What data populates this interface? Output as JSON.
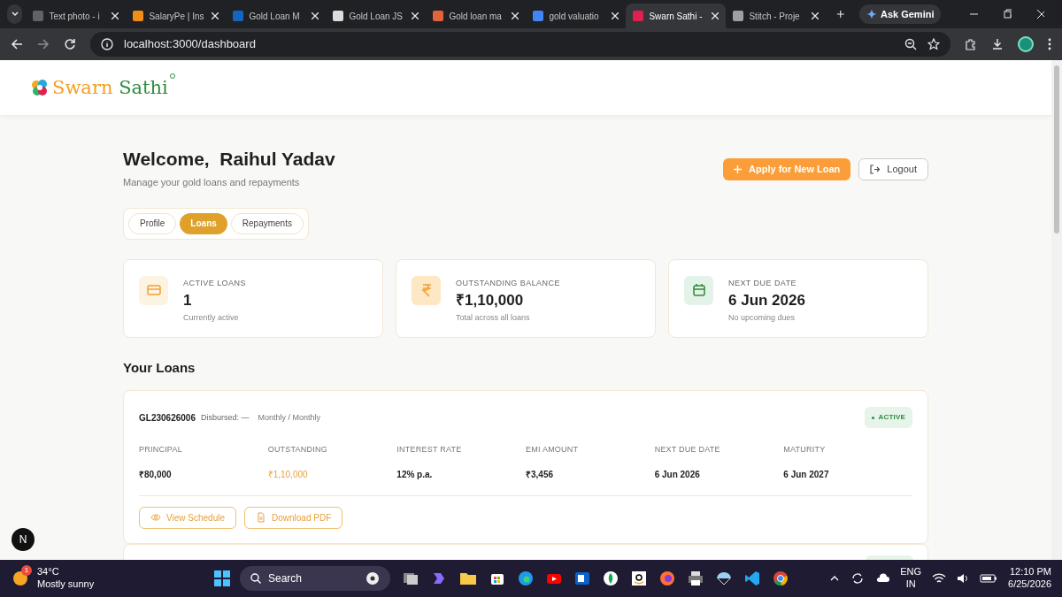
{
  "browser": {
    "tabs": [
      {
        "label": "Text photo - i",
        "selected": false
      },
      {
        "label": "SalaryPe | Ins",
        "selected": false
      },
      {
        "label": "Gold Loan M",
        "selected": false
      },
      {
        "label": "Gold Loan JS",
        "selected": false
      },
      {
        "label": "Gold loan ma",
        "selected": false
      },
      {
        "label": "gold valuatio",
        "selected": false
      },
      {
        "label": "Swarn Sathi -",
        "selected": true
      },
      {
        "label": "Stitch - Proje",
        "selected": false
      }
    ],
    "gemini": "Ask Gemini",
    "url": "localhost:3000/dashboard"
  },
  "header": {
    "logo_part_1": "Swarn ",
    "logo_part_2": "Sathi"
  },
  "welcome": {
    "title": "Welcome,  Raihul Yadav",
    "subtitle": "Manage your gold loans and repayments"
  },
  "actions": {
    "apply": "Apply for New Loan",
    "logout": "Logout"
  },
  "tabs": [
    {
      "label": "Profile",
      "selected": false
    },
    {
      "label": "Loans",
      "selected": true
    },
    {
      "label": "Repayments",
      "selected": false
    }
  ],
  "stats": [
    {
      "kind": "card",
      "label": "ACTIVE LOANS",
      "value": "1",
      "note": "Currently active"
    },
    {
      "kind": "rupee",
      "label": "OUTSTANDING BALANCE",
      "value": "₹1,10,000",
      "note": "Total across all loans"
    },
    {
      "kind": "calendar",
      "label": "NEXT DUE DATE",
      "value": "6 Jun 2026",
      "note": "No upcoming dues"
    }
  ],
  "loans_title": "Your Loans",
  "loans": [
    {
      "id": "GL230626006",
      "disbursed": "Disbursed: —",
      "frequency": "Monthly / Monthly",
      "status": "ACTIVE",
      "fields": [
        {
          "label": "PRINCIPAL",
          "value": "₹80,000",
          "highlighted": false
        },
        {
          "label": "OUTSTANDING",
          "value": "₹1,10,000",
          "highlighted": true
        },
        {
          "label": "INTEREST RATE",
          "value": "12% p.a.",
          "highlighted": false
        },
        {
          "label": "EMI AMOUNT",
          "value": "₹3,456",
          "highlighted": false
        },
        {
          "label": "NEXT DUE DATE",
          "value": "6 Jun 2026",
          "highlighted": false
        },
        {
          "label": "MATURITY",
          "value": "6 Jun 2027",
          "highlighted": false
        }
      ],
      "buttons": [
        {
          "kind": "eye",
          "label": "View Schedule"
        },
        {
          "kind": "file",
          "label": "Download PDF"
        }
      ]
    }
  ],
  "dev_badge": "N",
  "taskbar": {
    "weather_badge": "1",
    "temperature": "34°C",
    "weather": "Mostly sunny",
    "search": "Search",
    "language": "ENG",
    "region": "IN",
    "time": "12:10 PM",
    "date": "6/25/2026"
  }
}
